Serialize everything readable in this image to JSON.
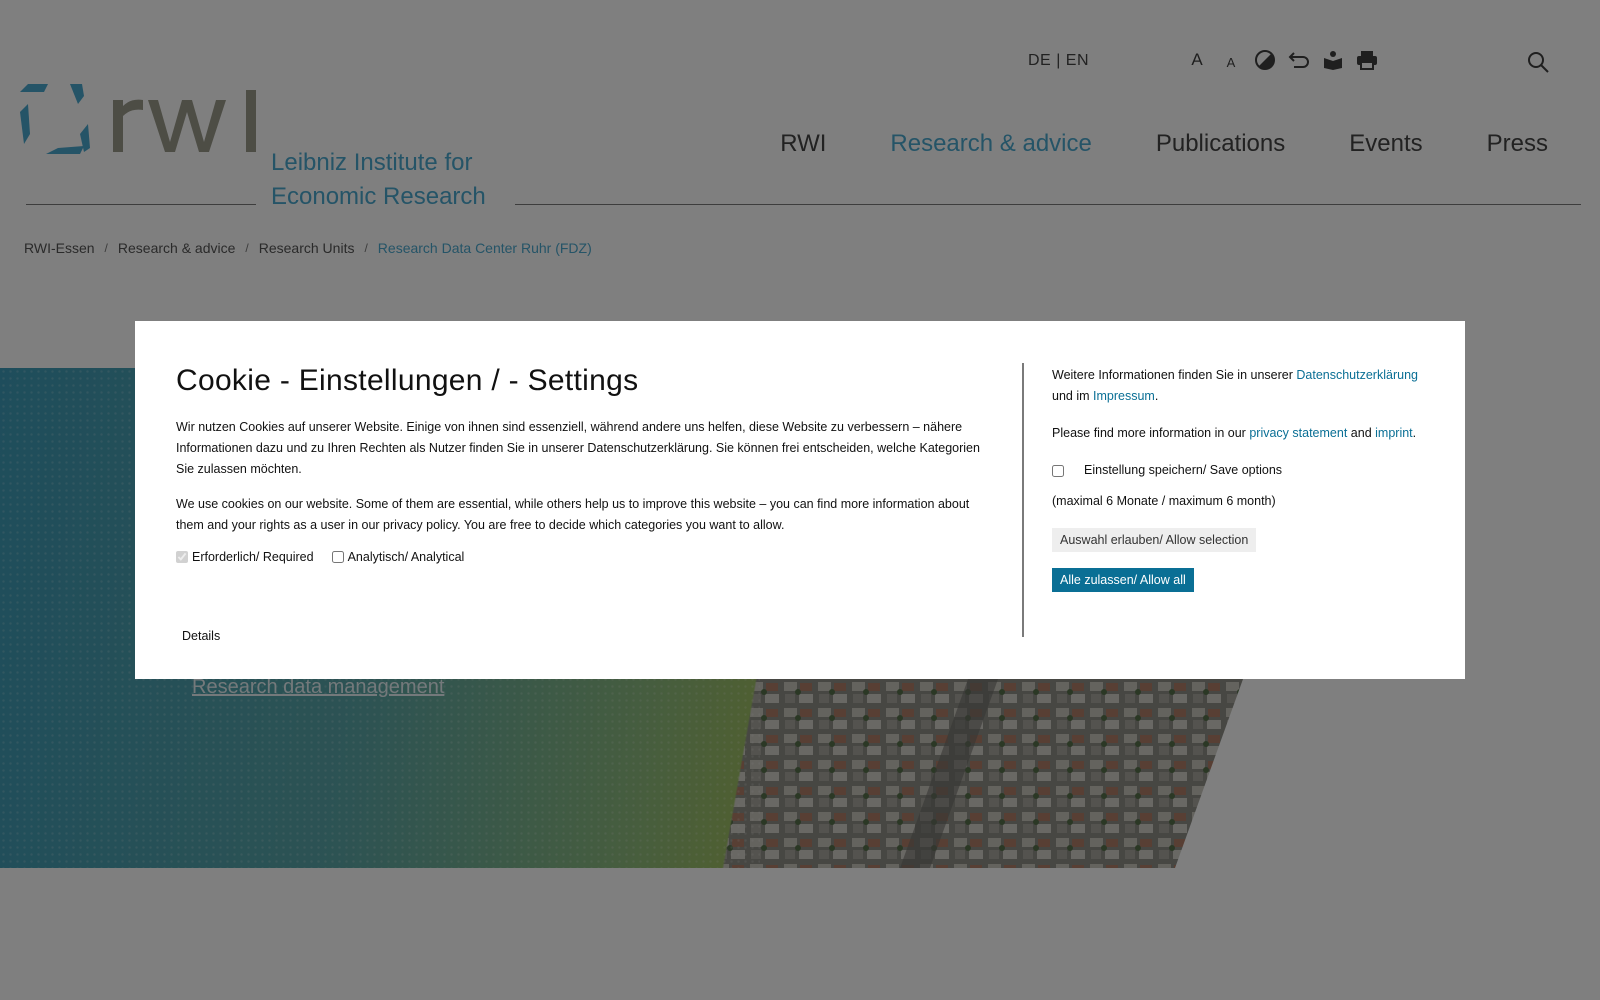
{
  "header": {
    "tagline_line1": "Leibniz Institute for",
    "tagline_line2": "Economic Research",
    "lang_de": "DE",
    "lang_sep": "|",
    "lang_en": "EN",
    "font_increase_label": "A",
    "font_decrease_label": "A"
  },
  "nav": {
    "items": [
      {
        "label": "RWI"
      },
      {
        "label": "Research & advice"
      },
      {
        "label": "Publications"
      },
      {
        "label": "Events"
      },
      {
        "label": "Press"
      }
    ],
    "active_index": 1
  },
  "breadcrumb": {
    "items": [
      "RWI-Essen",
      "Research & advice",
      "Research Units",
      "Research Data Center Ruhr (FDZ)"
    ],
    "separator": "/"
  },
  "hero": {
    "link_label": "Research data management"
  },
  "cookie_modal": {
    "title": "Cookie - Einstellungen / - Settings",
    "text_de": "Wir nutzen Cookies auf unserer Website. Einige von ihnen sind essenziell, während andere uns helfen, diese Website zu verbessern – nähere Informationen dazu und zu Ihren Rechten als Nutzer finden Sie in unserer Datenschutzerklärung. Sie können frei entscheiden, welche Kategorien Sie zulassen möchten.",
    "text_en": "We use cookies on our website. Some of them are essential, while others help us to improve this website – you can find more information about them and your rights as a user in our privacy policy. You are free to decide which categories you want to allow.",
    "checkbox_required": "Erforderlich/ Required",
    "checkbox_analytical": "Analytisch/ Analytical",
    "details_label": "Details",
    "info_de_prefix": "Weitere Informationen finden Sie in unserer",
    "info_de_link1": "Datenschutzerklärung",
    "info_de_mid": "und im",
    "info_de_link2": "Impressum",
    "info_en_prefix": "Please find more information in our",
    "info_en_link1": "privacy statement",
    "info_en_mid": "and",
    "info_en_link2": "imprint",
    "save_options_label": "Einstellung speichern/ Save options",
    "max_duration": "(maximal 6 Monate / maximum 6 month)",
    "allow_selection_button": "Auswahl erlauben/ Allow selection",
    "allow_all_button": "Alle zulassen/ Allow all"
  },
  "colors": {
    "accent": "#4aa8cf",
    "button_primary": "#0a6f95",
    "overlay": "rgba(0,0,0,0.5)"
  },
  "icons": [
    "rwi-logo",
    "contrast-icon",
    "back-icon",
    "easy-read-icon",
    "print-icon",
    "search-icon"
  ]
}
